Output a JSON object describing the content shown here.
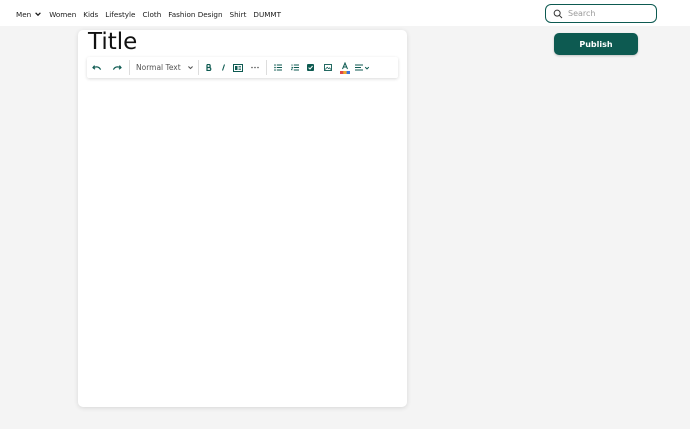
{
  "nav": {
    "items": [
      {
        "label": "Men",
        "has_dropdown": true
      },
      {
        "label": "Women"
      },
      {
        "label": "Kids"
      },
      {
        "label": "Lifestyle"
      },
      {
        "label": "Cloth"
      },
      {
        "label": "Fashion Design"
      },
      {
        "label": "Shirt"
      },
      {
        "label": "DUMMT"
      }
    ]
  },
  "search": {
    "placeholder": "Search"
  },
  "publish": {
    "label": "Publish"
  },
  "editor": {
    "title": "Title",
    "block_type": "Normal Text",
    "toolbar_icons": [
      "undo-icon",
      "redo-icon",
      "bold-icon",
      "italic-icon",
      "code-icon",
      "more-icon",
      "bullet-list-icon",
      "numbered-list-icon",
      "checkbox-icon",
      "image-icon",
      "text-color-icon",
      "align-icon"
    ]
  },
  "colors": {
    "accent": "#0d5a51",
    "background": "#f4f4f4",
    "card": "#ffffff"
  }
}
